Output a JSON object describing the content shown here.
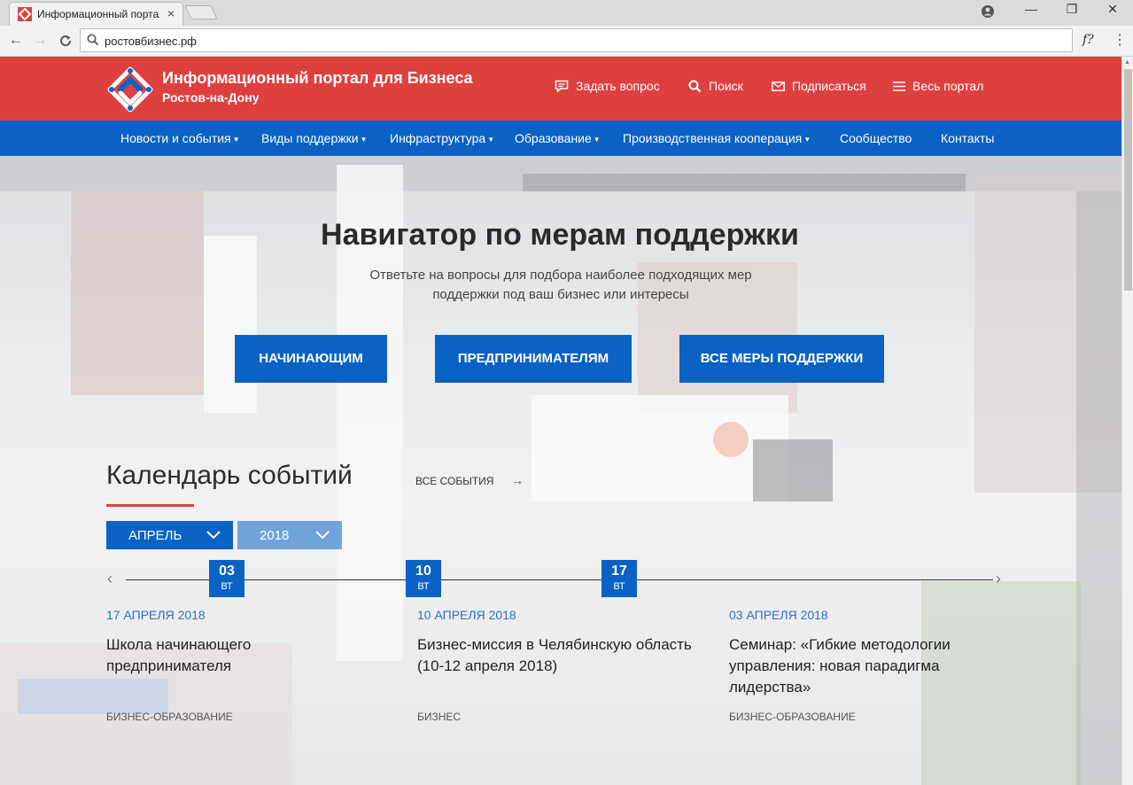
{
  "browser": {
    "tab_title": "Информационный портал",
    "tab_close": "×",
    "url": "ростовбизнес.рф",
    "extension_label": "f?",
    "window_minimize": "—",
    "window_maximize": "❐",
    "window_close": "✕"
  },
  "header": {
    "brand_title": "Информационный портал для Бизнеса",
    "brand_subtitle": "Ростов-на-Дону",
    "utility": [
      {
        "label": "Задать вопрос",
        "icon": "chat-icon"
      },
      {
        "label": "Поиск",
        "icon": "search-icon"
      },
      {
        "label": "Подписаться",
        "icon": "envelope-icon"
      },
      {
        "label": "Весь портал",
        "icon": "menu-icon"
      }
    ],
    "colors": {
      "topbar": "#de4040",
      "nav": "#0a62c4"
    }
  },
  "nav": {
    "items": [
      {
        "label": "Новости и события",
        "dropdown": true
      },
      {
        "label": "Виды поддержки",
        "dropdown": true
      },
      {
        "label": "Инфраструктура",
        "dropdown": true
      },
      {
        "label": "Образование",
        "dropdown": true
      },
      {
        "label": "Производственная кооперация",
        "dropdown": true
      },
      {
        "label": "Сообщество",
        "dropdown": false
      },
      {
        "label": "Контакты",
        "dropdown": false
      }
    ]
  },
  "hero": {
    "title": "Навигатор по мерам поддержки",
    "subtitle": "Ответьте на вопросы для подбора наиболее подходящих мер поддержки под ваш бизнес или интересы",
    "buttons": [
      "НАЧИНАЮЩИМ",
      "ПРЕДПРИНИМАТЕЛЯМ",
      "ВСЕ МЕРЫ ПОДДЕРЖКИ"
    ]
  },
  "calendar": {
    "title": "Календарь событий",
    "all_events": "ВСЕ СОБЫТИЯ",
    "month": "АПРЕЛЬ",
    "year": "2018",
    "days": [
      {
        "num": "03",
        "weekday": "ВТ"
      },
      {
        "num": "10",
        "weekday": "ВТ"
      },
      {
        "num": "17",
        "weekday": "ВТ"
      }
    ],
    "events": [
      {
        "date": "17 АПРЕЛЯ 2018",
        "title": "Школа начинающего предпринимателя",
        "category": "БИЗНЕС-ОБРАЗОВАНИЕ"
      },
      {
        "date": "10 АПРЕЛЯ 2018",
        "title": "Бизнес-миссия в Челябинскую область (10-12 апреля 2018)",
        "category": "БИЗНЕС"
      },
      {
        "date": "03 АПРЕЛЯ 2018",
        "title": "Семинар: «Гибкие методологии управления: новая парадигма лидерства»",
        "category": "БИЗНЕС-ОБРАЗОВАНИЕ"
      }
    ]
  }
}
